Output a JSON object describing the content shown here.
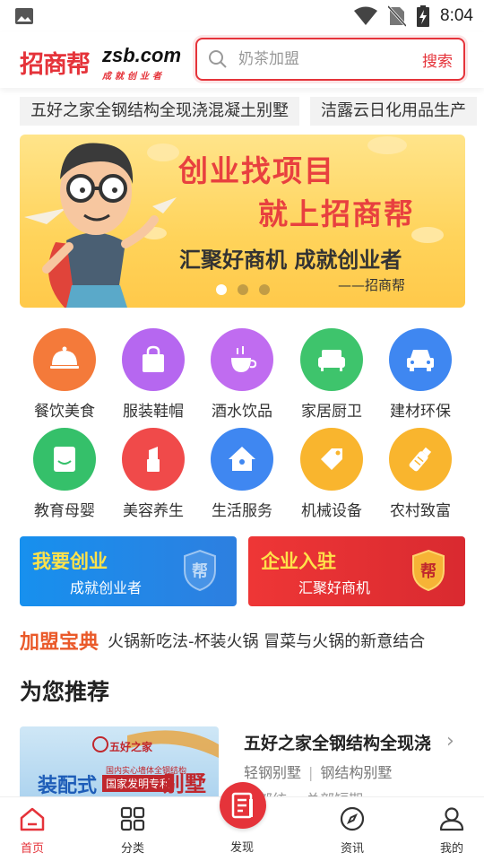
{
  "status_bar": {
    "time": "8:04"
  },
  "header": {
    "logo_cn": "招商帮",
    "logo_en": "zsb.com",
    "logo_sub": "成就创业者",
    "search_placeholder": "奶茶加盟",
    "search_button": "搜索"
  },
  "ticker": [
    "五好之家全钢结构全现浇混凝土别墅",
    "洁露云日化用品生产"
  ],
  "banner": {
    "line1": "创业找项目",
    "line2": "就上招商帮",
    "line3": "汇聚好商机 成就创业者",
    "line4": "——招商帮",
    "slide_count": 3,
    "active_slide": 0
  },
  "categories": [
    {
      "label": "餐饮美食",
      "icon": "food-cover-icon",
      "color": "#f47a3a"
    },
    {
      "label": "服装鞋帽",
      "icon": "shopping-bag-icon",
      "color": "#b667f0"
    },
    {
      "label": "酒水饮品",
      "icon": "coffee-cup-icon",
      "color": "#c06cf0"
    },
    {
      "label": "家居厨卫",
      "icon": "sofa-icon",
      "color": "#3ec46c"
    },
    {
      "label": "建材环保",
      "icon": "car-icon",
      "color": "#3f87f1"
    },
    {
      "label": "教育母婴",
      "icon": "book-icon",
      "color": "#35c06a"
    },
    {
      "label": "美容养生",
      "icon": "lipstick-icon",
      "color": "#f04a4a"
    },
    {
      "label": "生活服务",
      "icon": "home-icon",
      "color": "#3f87f1"
    },
    {
      "label": "机械设备",
      "icon": "tag-icon",
      "color": "#f9b52e"
    },
    {
      "label": "农村致富",
      "icon": "bottle-icon",
      "color": "#f9b52e"
    }
  ],
  "promos": [
    {
      "title": "我要创业",
      "subtitle": "成就创业者",
      "badge": "帮",
      "color": "#1f8fe8"
    },
    {
      "title": "企业入驻",
      "subtitle": "汇聚好商机",
      "badge": "帮",
      "color": "#e8333a"
    }
  ],
  "headline": {
    "tag": "加盟宝典",
    "text": "火锅新吃法-杯装火锅 冒菜与火锅的新意结合"
  },
  "recommend_title": "为您推荐",
  "recommend_items": [
    {
      "title": "五好之家全钢结构全现浇",
      "tags": [
        "轻钢别墅",
        "钢结构别墅"
      ],
      "more": "总部统一 总部短期",
      "thumb_brand": "五好之家",
      "thumb_left": "装配式",
      "thumb_right": "别墅",
      "thumb_mid": "国内实心墙体全钢结构",
      "thumb_red": "国家发明专利"
    }
  ],
  "tabbar": [
    {
      "label": "首页",
      "icon": "home-icon",
      "active": true
    },
    {
      "label": "分类",
      "icon": "grid-icon",
      "active": false
    },
    {
      "label": "发现",
      "icon": "document-icon",
      "active": false
    },
    {
      "label": "资讯",
      "icon": "compass-icon",
      "active": false
    },
    {
      "label": "我的",
      "icon": "user-icon",
      "active": false
    }
  ]
}
